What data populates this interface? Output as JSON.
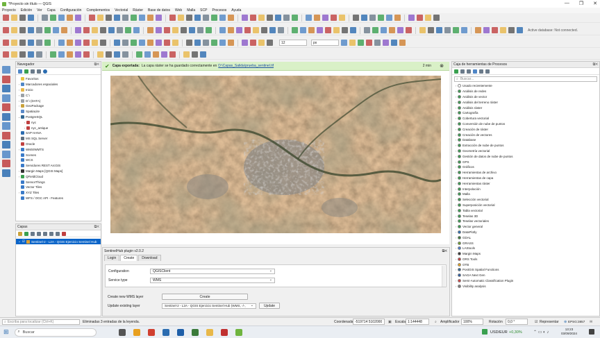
{
  "window": {
    "title": "*Proyecto sin título — QGIS",
    "minimize": "—",
    "restore": "❐",
    "close": "✕"
  },
  "menu": [
    "Proyecto",
    "Edición",
    "Ver",
    "Capa",
    "Configuración",
    "Complementos",
    "Vectorial",
    "Ráster",
    "Base de datos",
    "Web",
    "Malla",
    "SCP",
    "Procesos",
    "Ayuda"
  ],
  "toolbar": {
    "active_db_label": "Active database: Not connected.",
    "zoom_value": "12",
    "unit_value": "px"
  },
  "browser": {
    "title": "Navegador",
    "items": [
      {
        "label": "Favoritos",
        "indent": 0,
        "color": "#e8c440",
        "twisty": ""
      },
      {
        "label": "Marcadores espaciales",
        "indent": 0,
        "color": "#4f86c6",
        "twisty": "›"
      },
      {
        "label": "Inicio",
        "indent": 0,
        "color": "#e8b84a",
        "twisty": "›"
      },
      {
        "label": "C:\\",
        "indent": 0,
        "color": "#9aa0a6",
        "twisty": "›"
      },
      {
        "label": "D:\\ (DATA)",
        "indent": 0,
        "color": "#9aa0a6",
        "twisty": "›"
      },
      {
        "label": "GeoPackage",
        "indent": 0,
        "color": "#c9a13a",
        "twisty": "›"
      },
      {
        "label": "SpatiaLite",
        "indent": 0,
        "color": "#5a8ac8",
        "twisty": ""
      },
      {
        "label": "PostgreSQL",
        "indent": 0,
        "color": "#336791",
        "twisty": "⌄"
      },
      {
        "label": "nyc",
        "indent": 1,
        "color": "#c04040",
        "twisty": "›"
      },
      {
        "label": "nyc_antique",
        "indent": 1,
        "color": "#c04040",
        "twisty": "›"
      },
      {
        "label": "SAP HANA",
        "indent": 0,
        "color": "#2b6cb0",
        "twisty": ""
      },
      {
        "label": "MS SQL Server",
        "indent": 0,
        "color": "#607080",
        "twisty": ""
      },
      {
        "label": "Oracle",
        "indent": 0,
        "color": "#c04040",
        "twisty": ""
      },
      {
        "label": "WMS/WMTS",
        "indent": 0,
        "color": "#3a7ac8",
        "twisty": "›"
      },
      {
        "label": "Scenes",
        "indent": 0,
        "color": "#3a7ac8",
        "twisty": ""
      },
      {
        "label": "WCS",
        "indent": 0,
        "color": "#3a7ac8",
        "twisty": ""
      },
      {
        "label": "Servidores REST ArcGIS",
        "indent": 0,
        "color": "#3a7ac8",
        "twisty": ""
      },
      {
        "label": "Margin Maps [QGIS Maps]",
        "indent": 0,
        "color": "#333333",
        "twisty": "›"
      },
      {
        "label": "QFieldCloud",
        "indent": 0,
        "color": "#3aa050",
        "twisty": "›"
      },
      {
        "label": "SensorThings",
        "indent": 0,
        "color": "#3a7ac8",
        "twisty": ""
      },
      {
        "label": "Vector Tiles",
        "indent": 0,
        "color": "#3a7ac8",
        "twisty": ""
      },
      {
        "label": "XYZ Tiles",
        "indent": 0,
        "color": "#3a7ac8",
        "twisty": "›"
      },
      {
        "label": "WFS / OGC API - Features",
        "indent": 0,
        "color": "#3a7ac8",
        "twisty": ""
      }
    ]
  },
  "layers": {
    "title": "Capas",
    "items": [
      {
        "label": "Sentinel-2 - L2A - QGIS Ejercicio Sentinel Hub",
        "checked": true
      }
    ]
  },
  "message": {
    "title": "Capa exportada:",
    "text": "La capa ráster se ha guardado correctamente en",
    "link": "D:\\Capas_Salida\\prueba_sentinel.tif",
    "time": "2 min"
  },
  "sentinel": {
    "title": "SentinelHub plugin v2.0.2",
    "tabs": [
      "Login",
      "Create",
      "Download"
    ],
    "active_tab": "Create",
    "configuration_label": "Configuration",
    "configuration_value": "QGISClient",
    "service_type_label": "Service type",
    "service_type_value": "WMS",
    "create_new_label": "Create new WMS layer",
    "create_button": "Create",
    "update_label": "Update existing layer",
    "update_value": "Sentinel-2 - L2A - QGIS Ejercicio Sentinel Hub (WMS, -/-,",
    "update_button": "Update"
  },
  "processing": {
    "title": "Caja de herramientas de Procesos",
    "search_placeholder": "Buscar...",
    "items": [
      {
        "label": "Usado recientemente",
        "color": "#ffffff"
      },
      {
        "label": "Análisis de redes",
        "color": "#3a9a50"
      },
      {
        "label": "Análisis de vector",
        "color": "#3a9a50"
      },
      {
        "label": "Análisis del terreno ráster",
        "color": "#3a9a50"
      },
      {
        "label": "Análisis ráster",
        "color": "#3a9a50"
      },
      {
        "label": "Cartografía",
        "color": "#3a9a50"
      },
      {
        "label": "Cobertura vectorial",
        "color": "#3a9a50"
      },
      {
        "label": "Conversión de nube de puntos",
        "color": "#3a9a50"
      },
      {
        "label": "Creación de ráster",
        "color": "#3a9a50"
      },
      {
        "label": "Creación de vectores",
        "color": "#3a9a50"
      },
      {
        "label": "Database",
        "color": "#3a9a50"
      },
      {
        "label": "Extracción de nube de puntos",
        "color": "#3a9a50"
      },
      {
        "label": "Geometría vectorial",
        "color": "#3a9a50"
      },
      {
        "label": "Gestión de datos de nube de puntos",
        "color": "#3a9a50"
      },
      {
        "label": "GPS",
        "color": "#3a9a50"
      },
      {
        "label": "Gráficos",
        "color": "#3a9a50"
      },
      {
        "label": "Herramientas de archivo",
        "color": "#3a9a50"
      },
      {
        "label": "Herramientas de capa",
        "color": "#3a9a50"
      },
      {
        "label": "Herramientas ráster",
        "color": "#3a9a50"
      },
      {
        "label": "Interpolación",
        "color": "#3a9a50"
      },
      {
        "label": "Malla",
        "color": "#3a9a50"
      },
      {
        "label": "Selección vectorial",
        "color": "#3a9a50"
      },
      {
        "label": "Superposición vectorial",
        "color": "#3a9a50"
      },
      {
        "label": "Tabla vectorial",
        "color": "#3a9a50"
      },
      {
        "label": "Teselas 3D",
        "color": "#3a9a50"
      },
      {
        "label": "Teselas vectoriales",
        "color": "#3a9a50"
      },
      {
        "label": "Vector general",
        "color": "#3a9a50"
      },
      {
        "label": "DataPlotly",
        "color": "#2b6cb0"
      },
      {
        "label": "GDAL",
        "color": "#3a7a3a"
      },
      {
        "label": "GRASS",
        "color": "#6a9a30"
      },
      {
        "label": "LAStools",
        "color": "#4a7ac8"
      },
      {
        "label": "Margin Maps",
        "color": "#333333"
      },
      {
        "label": "ORS Tools",
        "color": "#c04040"
      },
      {
        "label": "OTB",
        "color": "#e0a020"
      },
      {
        "label": "PostGIS Spatial Functions",
        "color": "#336791"
      },
      {
        "label": "SAGA Next Gen",
        "color": "#2b5aa0"
      },
      {
        "label": "Semi-Automatic Classification Plugin",
        "color": "#cc4444"
      },
      {
        "label": "Visibility analysis",
        "color": "#7a7a7a"
      }
    ]
  },
  "status": {
    "locator_placeholder": "Escriba para localizar (Ctrl+K)",
    "message": "Eliminadas 3 entradas de la leyenda.",
    "coord_label": "Coordenada",
    "coord_value": "-519714  5102000",
    "scale_label": "Escala",
    "scale_value": "1:144448",
    "magnifier_label": "Amplificador",
    "magnifier_value": "100%",
    "rotation_label": "Rotación",
    "rotation_value": "0,0 °",
    "render_label": "Representar",
    "crs": "EPSG:3857"
  },
  "taskbar": {
    "search_placeholder": "Buscar",
    "ticker_name": "USD/EUR",
    "ticker_change": "+0,30%",
    "time": "13:23",
    "date": "03/09/2024"
  },
  "colors": {
    "accent": "#3c8a1e",
    "message_bg": "#d9f0c7",
    "selection": "#0a64c8"
  }
}
